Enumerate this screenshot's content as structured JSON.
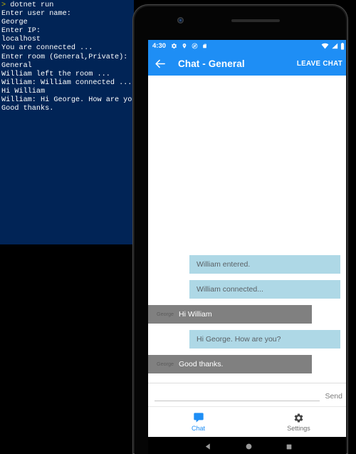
{
  "terminal": {
    "prompt_symbol": ">",
    "command": "dotnet run",
    "lines": [
      "Enter user name:",
      "George",
      "Enter IP:",
      "localhost",
      "You are connected ...",
      "Enter room (General,Private):",
      "General",
      "William left the room ...",
      "William: William connected ...",
      "Hi William",
      "William: Hi George. How are you?",
      "Good thanks."
    ],
    "background_color": "#012456",
    "text_color": "#ffffff",
    "prompt_color": "#c8b400"
  },
  "phone": {
    "statusbar": {
      "time": "4:30",
      "left_icons": [
        "gear-icon",
        "location-pin-icon",
        "do-not-disturb-icon",
        "sd-card-icon"
      ],
      "right_icons": [
        "wifi-icon",
        "cell-signal-icon",
        "battery-icon"
      ],
      "background_color": "#1e8ef5"
    },
    "appbar": {
      "back_icon": "back-arrow-icon",
      "title": "Chat - General",
      "action_label": "LEAVE CHAT",
      "background_color": "#1e8ef5"
    },
    "messages": [
      {
        "side": "right",
        "sender": "",
        "text": "William entered.",
        "style": "incoming"
      },
      {
        "side": "right",
        "sender": "",
        "text": "William connected...",
        "style": "incoming"
      },
      {
        "side": "left",
        "sender": "George",
        "text": "Hi William",
        "style": "outgoing"
      },
      {
        "side": "right",
        "sender": "",
        "text": "Hi George. How are you?",
        "style": "incoming"
      },
      {
        "side": "left",
        "sender": "George",
        "text": "Good thanks.",
        "style": "outgoing"
      }
    ],
    "colors": {
      "incoming_bubble": "#aed8e6",
      "outgoing_bubble": "#808080",
      "accent": "#1e8ef5"
    },
    "input": {
      "value": "",
      "placeholder": "",
      "send_label": "Send"
    },
    "bottom_nav": [
      {
        "label": "Chat",
        "icon": "chat-bubble-icon",
        "active": true
      },
      {
        "label": "Settings",
        "icon": "gear-icon",
        "active": false
      }
    ],
    "system_nav": [
      "back-triangle-icon",
      "home-circle-icon",
      "recents-square-icon"
    ]
  }
}
